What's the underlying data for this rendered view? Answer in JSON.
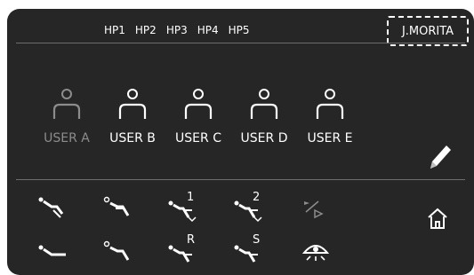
{
  "header": {
    "hp_buttons": [
      "HP1",
      "HP2",
      "HP3",
      "HP4",
      "HP5"
    ],
    "brand": "J.MORITA"
  },
  "users": [
    {
      "label": "USER A",
      "state": "inactive"
    },
    {
      "label": "USER B",
      "state": "active"
    },
    {
      "label": "USER C",
      "state": "active"
    },
    {
      "label": "USER D",
      "state": "active"
    },
    {
      "label": "USER E",
      "state": "active"
    }
  ],
  "tools": {
    "row1": [
      {
        "icon": "chair-position-1-icon",
        "tag": ""
      },
      {
        "icon": "chair-position-2-icon",
        "tag": ""
      },
      {
        "icon": "chair-memory-1-icon",
        "tag": "1"
      },
      {
        "icon": "chair-memory-2-icon",
        "tag": "2"
      },
      {
        "icon": "play-skip-icon",
        "tag": ""
      }
    ],
    "row2": [
      {
        "icon": "chair-recline-icon",
        "tag": ""
      },
      {
        "icon": "chair-upright-icon",
        "tag": ""
      },
      {
        "icon": "chair-return-icon",
        "tag": "R"
      },
      {
        "icon": "chair-spittoon-icon",
        "tag": "S"
      },
      {
        "icon": "operating-light-icon",
        "tag": ""
      }
    ]
  },
  "side": {
    "edit_icon": "pencil-icon",
    "home_icon": "home-icon"
  },
  "colors": {
    "panel": "#262626",
    "text": "#ffffff",
    "inactive": "#8c8c8c",
    "divider": "#6d6d6d"
  }
}
